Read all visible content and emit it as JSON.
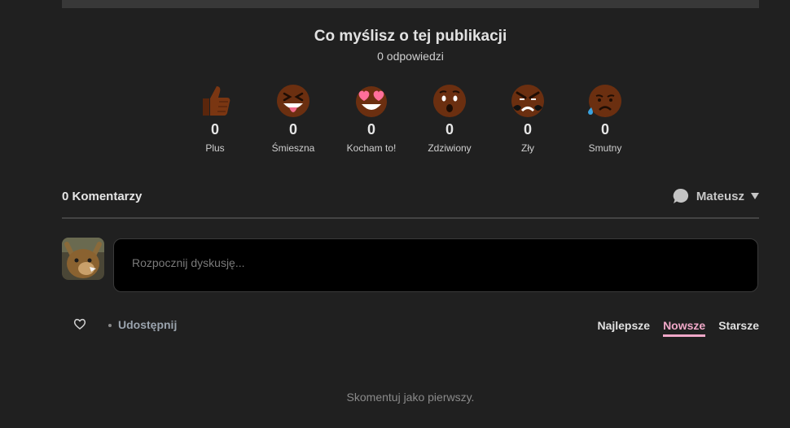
{
  "reactions": {
    "title": "Co myślisz o tej publikacji",
    "count_text": "0 odpowiedzi",
    "items": [
      {
        "icon": "thumbs-up-icon",
        "count": "0",
        "label": "Plus"
      },
      {
        "icon": "laughing-face-icon",
        "count": "0",
        "label": "Śmieszna"
      },
      {
        "icon": "heart-eyes-face-icon",
        "count": "0",
        "label": "Kocham to!"
      },
      {
        "icon": "surprised-face-icon",
        "count": "0",
        "label": "Zdziwiony"
      },
      {
        "icon": "angry-face-icon",
        "count": "0",
        "label": "Zły"
      },
      {
        "icon": "sad-face-icon",
        "count": "0",
        "label": "Smutny"
      }
    ]
  },
  "comments": {
    "count_text": "0 Komentarzy",
    "user_name": "Mateusz",
    "input_placeholder": "Rozpocznij dyskusję...",
    "share_label": "Udostępnij",
    "sort": {
      "best": "Najlepsze",
      "newest": "Nowsze",
      "oldest": "Starsze",
      "active": "newest"
    },
    "empty_message": "Skomentuj jako pierwszy."
  },
  "colors": {
    "background": "#202020",
    "accent": "#f0a8c8",
    "skin": "#6b2f10"
  }
}
